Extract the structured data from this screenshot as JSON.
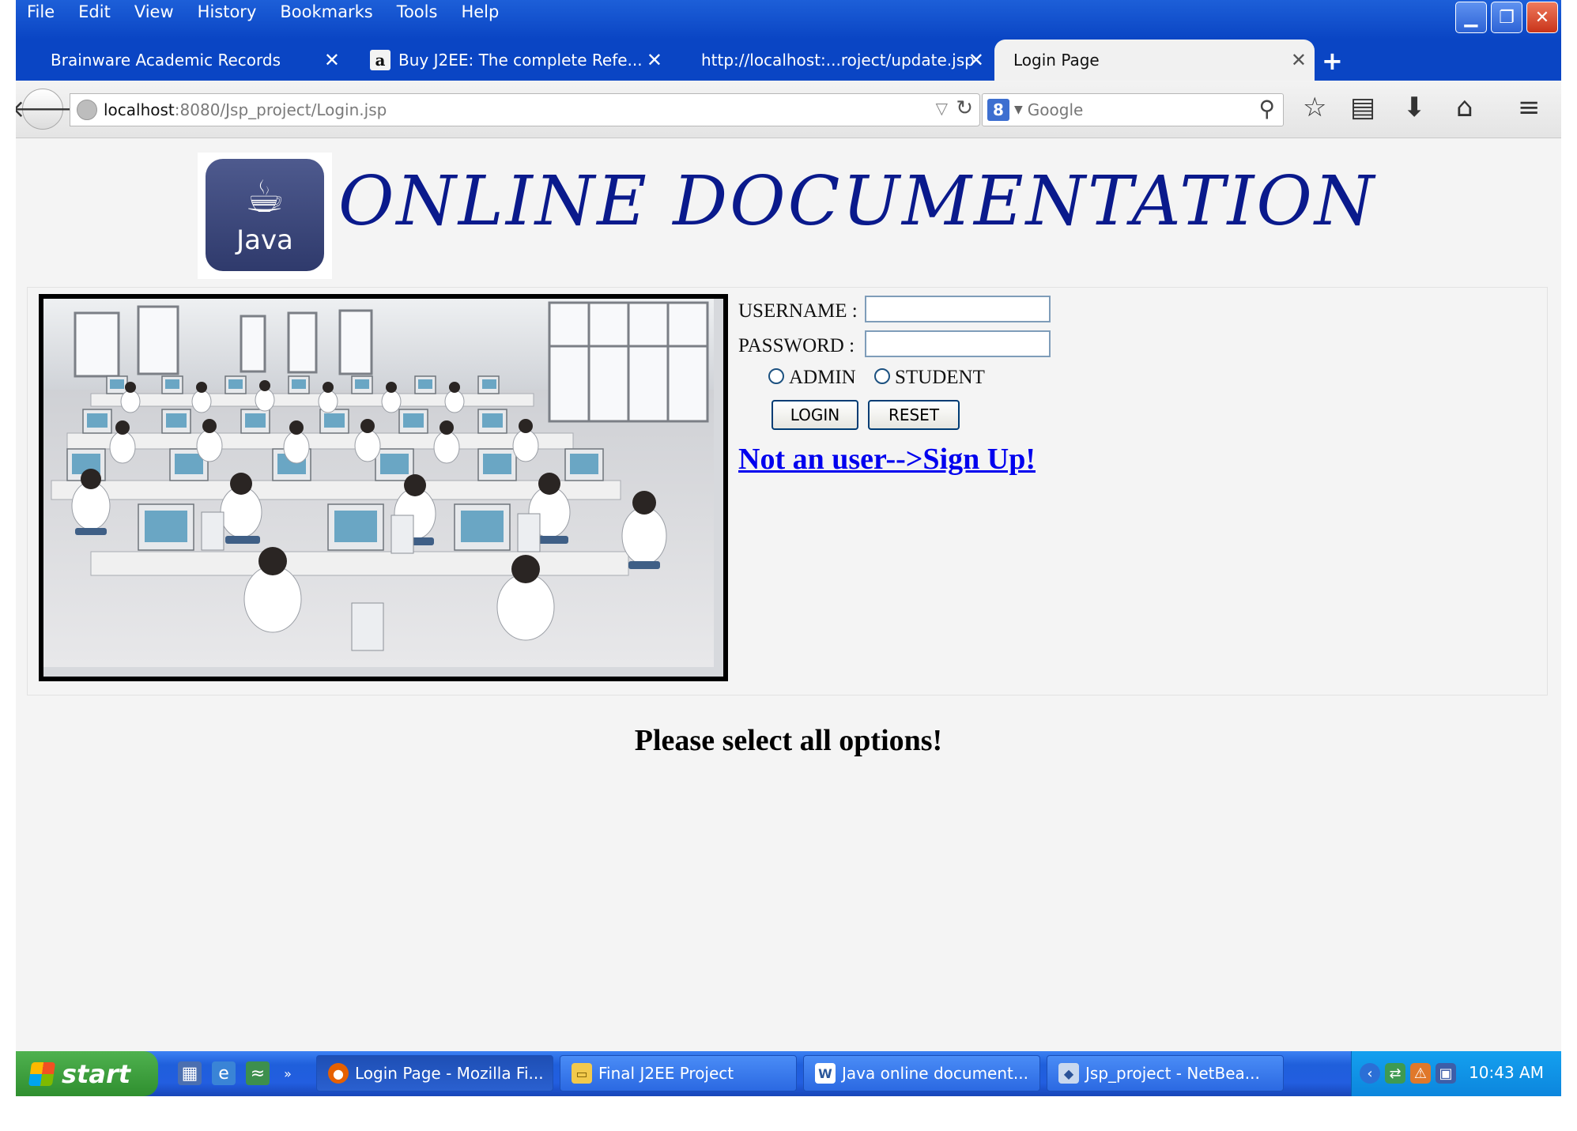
{
  "menubar": {
    "items": [
      "File",
      "Edit",
      "View",
      "History",
      "Bookmarks",
      "Tools",
      "Help"
    ]
  },
  "tabs": [
    {
      "label": "Brainware Academic Records"
    },
    {
      "label": "Buy J2EE: The complete Refe..."
    },
    {
      "label": "http://localhost:...roject/update.jsp"
    },
    {
      "label": "Login Page"
    }
  ],
  "navbar": {
    "url_host": "localhost",
    "url_rest": ":8080/Jsp_project/Login.jsp",
    "search_placeholder": "Google"
  },
  "page": {
    "logo_text": "Java",
    "title": "ONLINE DOCUMENTATION",
    "form": {
      "username_label": "USERNAME :",
      "password_label": "PASSWORD :",
      "role_admin": "ADMIN",
      "role_student": "STUDENT",
      "login_label": "LOGIN",
      "reset_label": "RESET"
    },
    "signup_link": "Not an user-->Sign Up!",
    "status_message": "Please select all options!"
  },
  "taskbar": {
    "start_label": "start",
    "buttons": [
      {
        "label": "Login Page - Mozilla Fi..."
      },
      {
        "label": "Final J2EE Project"
      },
      {
        "label": "Java online document..."
      },
      {
        "label": "Jsp_project - NetBea..."
      }
    ],
    "clock": "10:43 AM"
  },
  "colors": {
    "title_navy": "#0a1a8c",
    "link_blue": "#0000ee",
    "xp_blue": "#0a45c4"
  }
}
